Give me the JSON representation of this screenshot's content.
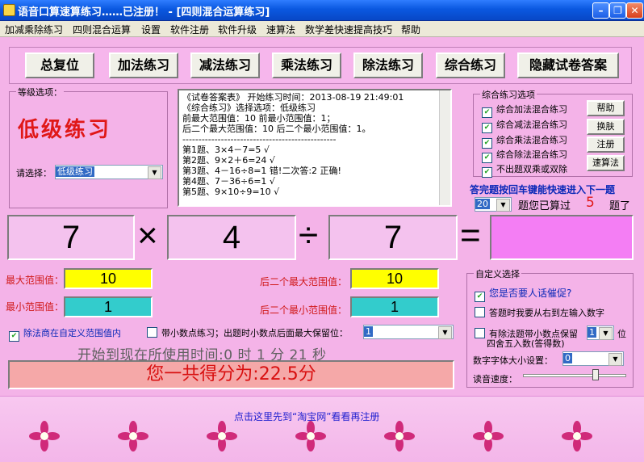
{
  "window": {
    "title": "语音口算速算练习……已注册！  - [四则混合运算练习]"
  },
  "menu": [
    "加减乘除练习",
    "四则混合运算",
    "设置",
    "软件注册",
    "软件升级",
    "速算法",
    "数学差快速提高技巧",
    "帮助"
  ],
  "toolbar": {
    "reset": "总复位",
    "add": "加法练习",
    "sub": "减法练习",
    "mul": "乘法练习",
    "div": "除法练习",
    "mixed": "综合练习",
    "hide_answers": "隐藏试卷答案"
  },
  "level": {
    "group_title": "等级选项：",
    "current": "低级练习",
    "select_label": "请选择：",
    "select_value": "低级练习"
  },
  "answer_sheet": {
    "lines": [
      "《试卷答案表》  开始练习时间：2013-08-19 21:49:01",
      "《综合练习》选择选项：低级练习",
      "    前最大范围值：10   前最小范围值：1；",
      "后二个最大范围值：10   后二个最小范围值：1。",
      "------------------------------------------------",
      "第1题、3×4－7=5  √",
      "第2题、9×2＋6=24  √",
      "第3题、4－16÷8=1  错!二次答:2  正确!",
      "第4题、7－36÷6=1  √",
      "第5题、9×10÷9=10  √"
    ]
  },
  "mixed_options": {
    "group_title": "综合练习选项",
    "items": [
      {
        "label": "综合加法混合练习",
        "checked": true
      },
      {
        "label": "综合减法混合练习",
        "checked": true
      },
      {
        "label": "综合乘法混合练习",
        "checked": true
      },
      {
        "label": "综合除法混合练习",
        "checked": true
      },
      {
        "label": "不出题双乘或双除",
        "checked": true
      }
    ],
    "buttons": [
      "帮助",
      "换肤",
      "注册",
      "速算法"
    ]
  },
  "hint": "答完题按回车键能快速进入下一题",
  "progress": {
    "count_select": "20",
    "label_before": "题您已算过",
    "done": "5",
    "label_after": "题了"
  },
  "equation": {
    "a": "7",
    "op1": "×",
    "b": "4",
    "op2": "÷",
    "c": "7",
    "eq": "=",
    "answer": ""
  },
  "ranges": {
    "max_label": "最大范围值：",
    "max_value": "10",
    "min_label": "最小范围值：",
    "min_value": "1",
    "max2_label": "后二个最大范围值：",
    "max2_value": "10",
    "min2_label": "后二个最小范围值：",
    "min2_value": "1",
    "colors": {
      "max": "#ffff00",
      "min": "#33cccc"
    }
  },
  "options_row": {
    "div_in_range": "除法商在自定义范围值内",
    "decimal": "带小数点练习；出题时小数点后面最大保留位：",
    "decimal_places": "1"
  },
  "custom": {
    "group_title": "自定义选择",
    "prompt": "您是否要人话催促?",
    "right_to_left": "答题时我要从右到左输入数字",
    "round_label_1": "有除法题带小数点保留",
    "round_label_2": "四舍五入数(答得数)",
    "round_value": "1",
    "round_unit": "位",
    "font_size_label": "数字字体大小设置：",
    "font_size_value": "0",
    "speed_label": "读音速度：",
    "speed_level": 0.72
  },
  "timer": "开始到现在所使用时间:0 时 1 分 21 秒",
  "score": "您一共得分为:22.5分",
  "footer": {
    "link": "点击这里先到“淘宝网”看看再注册"
  }
}
